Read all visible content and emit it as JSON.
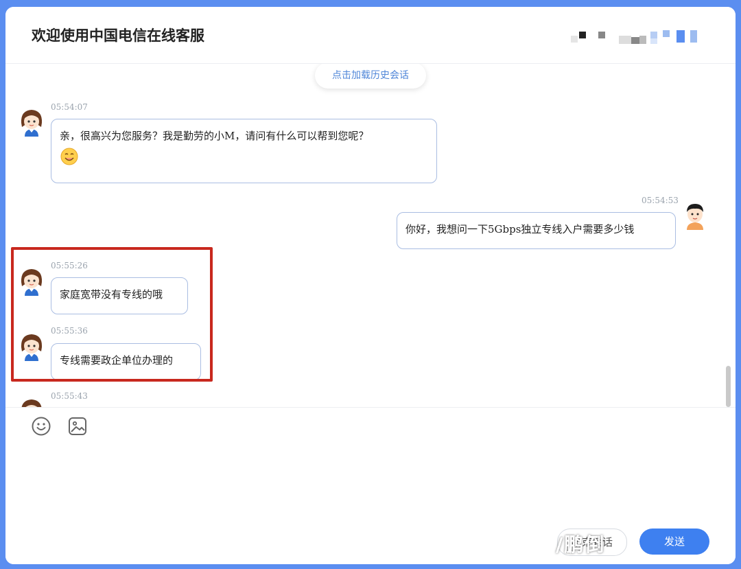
{
  "header": {
    "title": "欢迎使用中国电信在线客服"
  },
  "chat": {
    "load_history_label": "点击加载历史会话",
    "messages": [
      {
        "side": "agent",
        "time": "05:54:07",
        "text": "亲，很高兴为您服务？我是勤劳的小M，请问有什么可以帮到您呢？",
        "emoji": "smile-emoji"
      },
      {
        "side": "user",
        "time": "05:54:53",
        "text": "你好，我想问一下5Gbps独立专线入户需要多少钱"
      },
      {
        "side": "agent",
        "time": "05:55:26",
        "text": "家庭宽带没有专线的哦"
      },
      {
        "side": "agent",
        "time": "05:55:36",
        "text": "专线需要政企单位办理的"
      },
      {
        "side": "agent",
        "time": "05:55:43",
        "text": ""
      }
    ]
  },
  "toolbar": {
    "icons": [
      "emoji-icon",
      "image-icon"
    ]
  },
  "actions": {
    "end_label": "结束会话",
    "send_label": "发送"
  },
  "watermark": "/鹏倒",
  "colors": {
    "accent": "#3e80f0",
    "highlight": "#c8281e",
    "bubble_border": "#a9bde2",
    "background": "#5b8ef0"
  }
}
